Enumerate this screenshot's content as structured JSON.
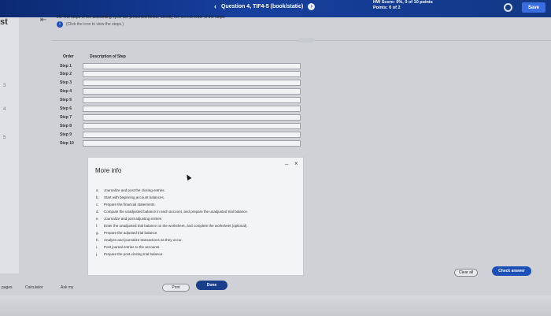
{
  "header": {
    "question_nav": "Question 4, TIF4-5 (book/static)",
    "hw_score": "HW Score: 0%, 0 of 10 points",
    "points": "Points: 0 of 2",
    "save_label": "Save",
    "colors": {
      "bar": "#173f9e",
      "save": "#3a6ee0"
    }
  },
  "sidebar": {
    "label": "st",
    "numbers": [
      "3",
      "4",
      "5"
    ]
  },
  "question": {
    "text": "21. The steps of the accounting cycle are presented below. Identify the correct order of the steps.",
    "hint": "(Click the icon to view the steps.)"
  },
  "table": {
    "order_header": "Order",
    "desc_header": "Description of Step",
    "steps": [
      "Step 1",
      "Step 2",
      "Step 3",
      "Step 4",
      "Step 5",
      "Step 6",
      "Step 7",
      "Step 8",
      "Step 9",
      "Step 10"
    ]
  },
  "dialog": {
    "title": "More info",
    "items": [
      {
        "letter": "a.",
        "text": "Journalize and post the closing entries."
      },
      {
        "letter": "b.",
        "text": "Start with beginning account balances."
      },
      {
        "letter": "c.",
        "text": "Prepare the financial statements."
      },
      {
        "letter": "d.",
        "text": "Compute the unadjusted balance in each account, and prepare the unadjusted trial balance."
      },
      {
        "letter": "e.",
        "text": "Journalize and post adjusting entries."
      },
      {
        "letter": "f.",
        "text": "Enter the unadjusted trial balance on the worksheet, and complete the worksheet (optional)."
      },
      {
        "letter": "g.",
        "text": "Prepare the adjusted trial balance."
      },
      {
        "letter": "h.",
        "text": "Analyze and journalize transactions as they occur."
      },
      {
        "letter": "i.",
        "text": "Post journal entries to the accounts."
      },
      {
        "letter": "j.",
        "text": "Prepare the post-closing trial balance."
      }
    ],
    "print_label": "Print",
    "done_label": "Done"
  },
  "actions": {
    "clear_label": "Clear all",
    "check_label": "Check answer"
  },
  "bottom": {
    "pages": "pages",
    "calculator": "Calculator",
    "ask": "Ask my"
  }
}
